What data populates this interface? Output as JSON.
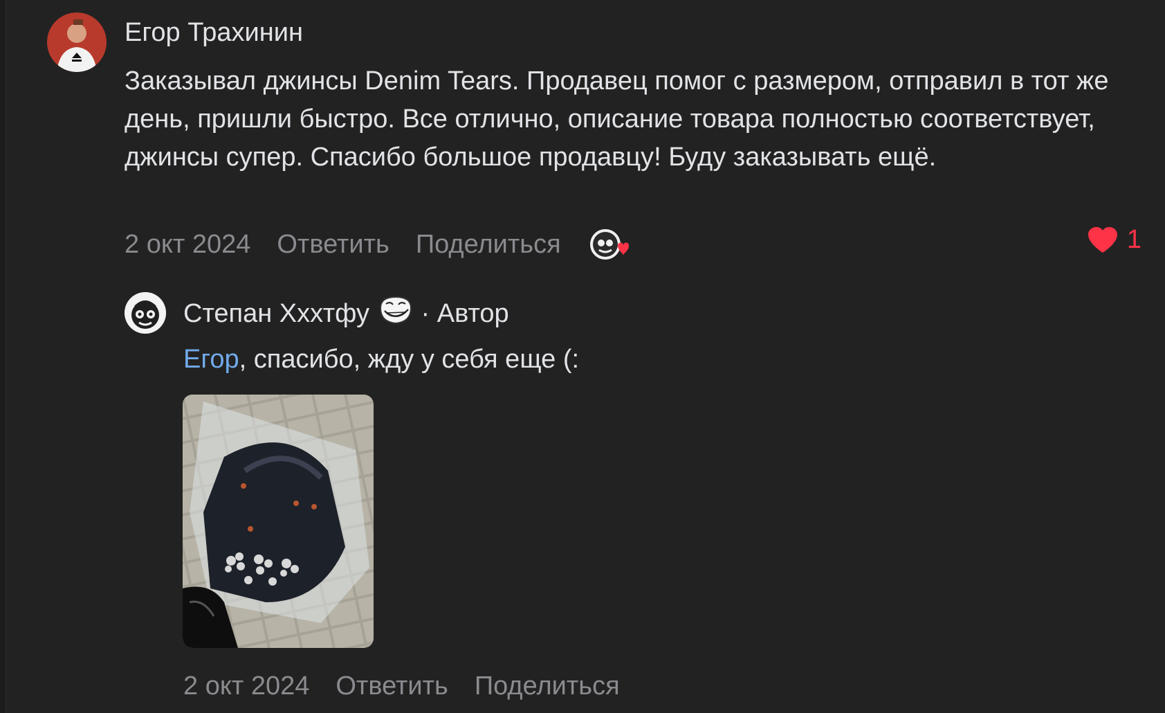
{
  "comment": {
    "author": "Егор Трахинин",
    "text": "Заказывал джинсы Denim Tears. Продавец помог с размером, отправил в тот же день, пришли быстро. Все отлично, описание товара полностью соответствует, джинсы супер. Спасибо большое продавцу! Буду заказывать ещё.",
    "date": "2 окт 2024",
    "reply_label": "Ответить",
    "share_label": "Поделиться",
    "likes_count": "1",
    "like_icon": "heart-icon",
    "like_color": "#ff3347"
  },
  "reply": {
    "author": "Степан Хххтфу",
    "author_badge_sep": " · ",
    "author_role": "Автор",
    "mention": "Егор",
    "text": ", спасибо, жду у себя еще (:",
    "date": "2 окт 2024",
    "reply_label": "Ответить",
    "share_label": "Поделиться",
    "mention_color": "#71aaeb"
  }
}
